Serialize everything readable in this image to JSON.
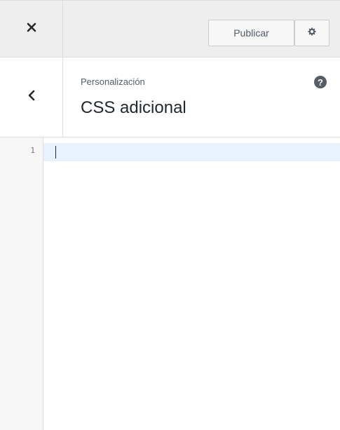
{
  "header": {
    "close_icon": "close-icon",
    "publish_label": "Publicar",
    "settings_icon": "gear-icon"
  },
  "section": {
    "back_icon": "chevron-left-icon",
    "breadcrumb": "Personalización",
    "title": "CSS adicional",
    "help_icon": "question-mark-icon",
    "help_glyph": "?"
  },
  "editor": {
    "lines": [
      "1"
    ],
    "content": ""
  },
  "colors": {
    "header_bg": "#eeeeee",
    "active_line": "#e8f2fe",
    "gutter_bg": "#f7f7f7"
  }
}
